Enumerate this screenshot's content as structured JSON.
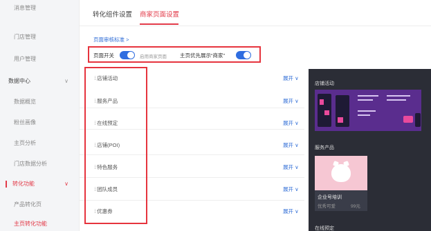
{
  "sidebar": {
    "items": [
      {
        "label": "消息管理"
      },
      {
        "label": "门店管理"
      },
      {
        "label": "用户管理"
      },
      {
        "label": "数据中心",
        "chevron": "∨"
      },
      {
        "label": "数据概览"
      },
      {
        "label": "粉丝画像"
      },
      {
        "label": "主页分析"
      },
      {
        "label": "门店数据分析"
      },
      {
        "label": "转化功能",
        "chevron": "∨"
      },
      {
        "label": "产品转化页"
      },
      {
        "label": "主页转化功能"
      }
    ]
  },
  "tabs": [
    {
      "label": "转化组件设置"
    },
    {
      "label": "商家页面设置"
    }
  ],
  "page_standard_link": "页面审核标准 >",
  "toggles": {
    "page_switch_label": "页面开关",
    "page_switch_hint": "启用商家页面",
    "homepage_label": "主页优先展示“商家”"
  },
  "modules": [
    {
      "label": "店铺活动",
      "expand": "展开 ∨"
    },
    {
      "label": "服务产品",
      "expand": "展开 ∨"
    },
    {
      "label": "在线预定",
      "expand": "展开 ∨"
    },
    {
      "label": "店铺(POI)",
      "expand": "展开 ∨"
    },
    {
      "label": "特色服务",
      "expand": "展开 ∨"
    },
    {
      "label": "团队成员",
      "expand": "展开 ∨"
    },
    {
      "label": "优惠券",
      "expand": "展开 ∨"
    }
  ],
  "preview": {
    "section_activity": "店铺活动",
    "section_products": "服务产品",
    "section_booking": "在线预定",
    "product_card": {
      "title": "企业号培训",
      "subtitle": "优秀可爱",
      "price": "99元"
    }
  },
  "colors": {
    "accent": "#e23a48",
    "link": "#2d6bd6",
    "switch_on": "#2f6de0",
    "preview_bg": "#2b2d36"
  }
}
